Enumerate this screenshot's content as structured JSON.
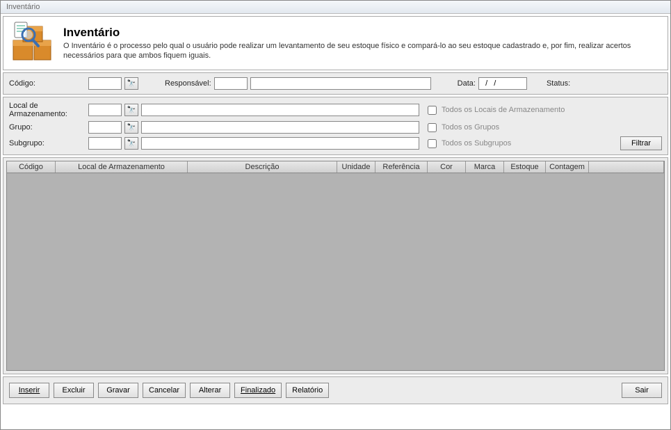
{
  "window": {
    "title": "Inventário"
  },
  "header": {
    "title": "Inventário",
    "description": "O Inventário é o processo pelo qual o usuário pode realizar um levantamento de seu estoque físico e compará-lo ao seu estoque cadastrado e, por fim, realizar acertos necessários para que ambos fiquem iguais."
  },
  "filters": {
    "row1": {
      "codigo_label": "Código:",
      "codigo_value": "",
      "responsavel_label": "Responsável:",
      "responsavel_code": "",
      "responsavel_name": "",
      "data_label": "Data:",
      "data_value": "  /   /",
      "status_label": "Status:",
      "status_value": ""
    },
    "row2": {
      "local_label": "Local de Armazenamento:",
      "local_code": "",
      "local_name": "",
      "local_all": "Todos os Locais de Armazenamento"
    },
    "row3": {
      "grupo_label": "Grupo:",
      "grupo_code": "",
      "grupo_name": "",
      "grupo_all": "Todos os Grupos"
    },
    "row4": {
      "sub_label": "Subgrupo:",
      "sub_code": "",
      "sub_name": "",
      "sub_all": "Todos os Subgrupos"
    },
    "filtrar": "Filtrar"
  },
  "grid": {
    "columns": [
      "Código",
      "Local de Armazenamento",
      "Descrição",
      "Unidade",
      "Referência",
      "Cor",
      "Marca",
      "Estoque",
      "Contagem"
    ],
    "widths": [
      70,
      190,
      215,
      55,
      75,
      55,
      55,
      60,
      62
    ]
  },
  "buttons": {
    "inserir": "Inserir",
    "excluir": "Excluir",
    "gravar": "Gravar",
    "cancelar": "Cancelar",
    "alterar": "Alterar",
    "finalizado": "Finalizado",
    "relatorio": "Relatório",
    "sair": "Sair"
  }
}
